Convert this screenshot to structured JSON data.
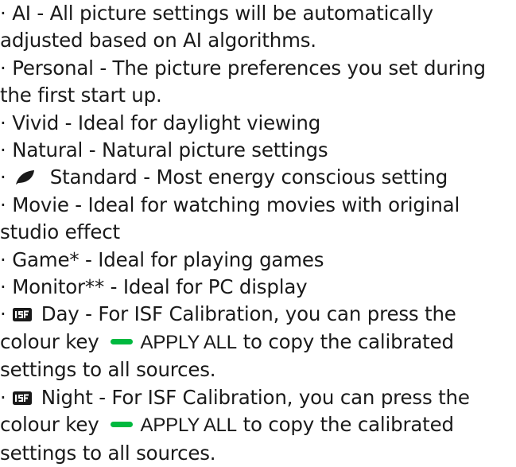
{
  "items": [
    {
      "bullet": "·",
      "line1": "AI - All picture settings will be automatically",
      "line2": "adjusted based on AI algorithms."
    },
    {
      "bullet": "·",
      "line1": "Personal - The picture preferences you set during",
      "line2": "the first start up."
    },
    {
      "bullet": "·",
      "line1": "Vivid - Ideal for daylight viewing"
    },
    {
      "bullet": "·",
      "line1": "Natural - Natural picture settings"
    },
    {
      "bullet": "·",
      "icon": "eco-leaf-icon",
      "line1": "Standard - Most energy conscious setting"
    },
    {
      "bullet": "·",
      "line1": "Movie - Ideal for watching movies with original",
      "line2": "studio effect"
    },
    {
      "bullet": "·",
      "line1": "Game* - Ideal for playing games"
    },
    {
      "bullet": "·",
      "line1": "Monitor** - Ideal for PC display"
    },
    {
      "bullet": "·",
      "icon": "isf-icon",
      "line1": "Day - For ISF Calibration, you can press the",
      "line2a": "colour key",
      "key_icon": "green-key-icon",
      "apply_label": "APPLY ALL",
      "line2b": "to copy the calibrated",
      "line3": "settings to all sources."
    },
    {
      "bullet": "·",
      "icon": "isf-icon",
      "line1": "Night - For ISF Calibration, you can press the",
      "line2a": "colour key",
      "key_icon": "green-key-icon",
      "apply_label": "APPLY ALL",
      "line2b": "to copy the calibrated",
      "line3": "settings to all sources."
    }
  ],
  "colors": {
    "text": "#1a1a1a",
    "green_key": "#00b93f",
    "background": "#ffffff"
  }
}
